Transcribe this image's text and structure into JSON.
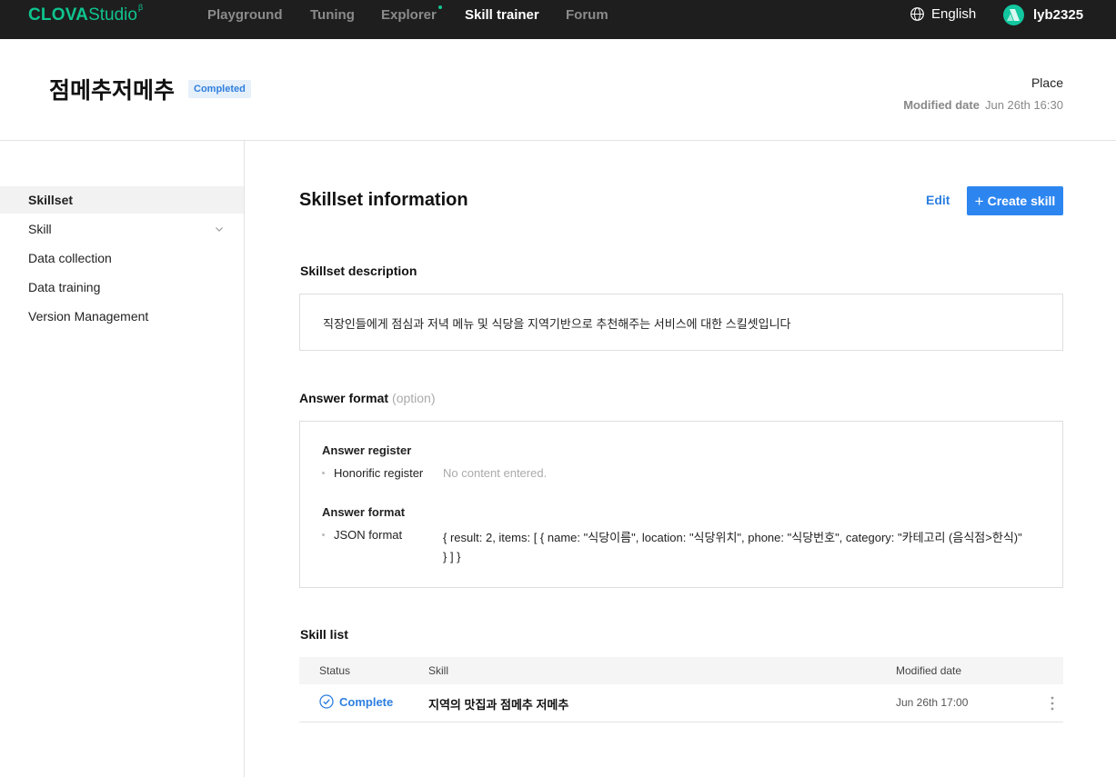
{
  "topbar": {
    "logo_strong": "CLOVA",
    "logo_light": "Studio",
    "logo_sup": "β",
    "nav": [
      "Playground",
      "Tuning",
      "Explorer",
      "Skill trainer",
      "Forum"
    ],
    "active_nav": "Skill trainer",
    "language": "English",
    "username": "lyb2325",
    "accent_color": "#0fc48f"
  },
  "header": {
    "title": "점메추저메추",
    "status_badge": "Completed",
    "category": "Place",
    "modified_label": "Modified date",
    "modified_value": "Jun 26th 16:30"
  },
  "sidebar": {
    "items": [
      {
        "label": "Skillset",
        "active": true
      },
      {
        "label": "Skill",
        "expandable": true
      },
      {
        "label": "Data collection"
      },
      {
        "label": "Data training"
      },
      {
        "label": "Version Management"
      }
    ]
  },
  "main": {
    "section_title": "Skillset information",
    "edit_label": "Edit",
    "create_label": "Create skill",
    "description_label": "Skillset description",
    "description_text": "직장인들에게 점심과 저녁 메뉴 및 식당을 지역기반으로 추천해주는 서비스에 대한 스킬셋입니다",
    "answer_format_label": "Answer format",
    "answer_format_option": "(option)",
    "answer_register_head": "Answer register",
    "honorific_key": "Honorific register",
    "honorific_value": "No content entered.",
    "answer_format_head": "Answer format",
    "json_key": "JSON format",
    "json_value": "{ result: 2, items: [ { name: \"식당이름\", location: \"식당위치\", phone: \"식당번호\", category: \"카테고리 (음식점>한식)\" } ] }",
    "skill_list_label": "Skill list"
  },
  "skill_table": {
    "columns": [
      "Status",
      "Skill",
      "Modified date"
    ],
    "rows": [
      {
        "status": "Complete",
        "skill": "지역의 맛집과 점메추 저메추",
        "modified": "Jun 26th 17:00"
      }
    ]
  }
}
